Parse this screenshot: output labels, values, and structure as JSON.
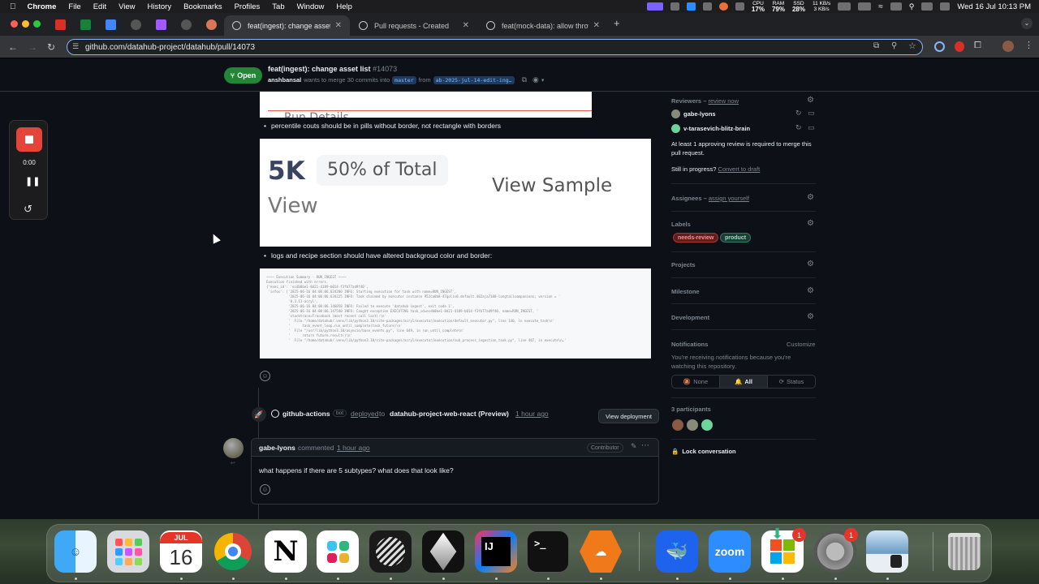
{
  "menubar": {
    "app": "Chrome",
    "items": [
      "File",
      "Edit",
      "View",
      "History",
      "Bookmarks",
      "Profiles",
      "Tab",
      "Window",
      "Help"
    ],
    "cpu_label": "CPU",
    "cpu": "17%",
    "ram_label": "RAM",
    "ram": "79%",
    "ssd_label": "SSD",
    "ssd": "28%",
    "net_up": "11 KB/s",
    "net_down": "3 KB/s",
    "clock": "Wed 16 Jul 10:13 PM"
  },
  "tabs": [
    {
      "title": "feat(ingest): change asset lis"
    },
    {
      "title": "Pull requests - Created"
    },
    {
      "title": "feat(mock-data): allow throw"
    }
  ],
  "address": {
    "url": "github.com/datahub-project/datahub/pull/14073"
  },
  "pr": {
    "status": "Open",
    "title": "feat(ingest): change asset list",
    "number": "#14073",
    "author": "anshbansal",
    "merge_text": "wants to merge 30 commits into",
    "base": "master",
    "from_text": "from",
    "head": "ab-2025-jul-14-edit-ing…"
  },
  "recorder": {
    "time": "0:00"
  },
  "comment": {
    "bullet1": "percentile couts should be in pills without border, not rectangle with borders",
    "img_partial": "Run Details",
    "img_count": "5K",
    "img_percent": "50% of Total",
    "img_view": "View",
    "img_sample": "View Sample",
    "bullet2": "logs and recipe section should have altered backgroud color and border:",
    "logs": [
      "~~~~ Execution Summary - RUN_INGEST ~~~~",
      "Execution finished with errors.",
      "{'exec_id': 'ecdb0be1-8d21-4189-b014-f3fb77ad9f40',",
      " 'infos': ['2025-06-16 04:00:06.624200 INFO: Starting execution for task with name=RUN_INGEST',",
      "           '2025-06-16 04:00:06.634225 INFO: Task claimed by executor instance 952ca0b8-47golis0.default.482aja7180-longtailcompanions; version = '",
      "           '0.3.11-acryl',",
      "           '2025-06-16 04:00:06.146058 INFO: Failed to execute 'datahub ingest', exit code 1',",
      "           '2025-06-16 04:00:06.147540 INFO: Caught exception EXECUTING task_id=ecdb0be1-8d21-4189-b014-f3fb77ad9f40, name=RUN_INGEST, '",
      "           'stacktrace=Traceback (most recent call last):\\n'",
      "           '  File \"/home/datahub/.venv/lib/python3.10/site-packages/acryl/executor/execution/default_executor.py\", line 140, in execute_task\\n'",
      "           '      task_event_loop.run_until_complete(task_future)\\n'",
      "           '  File \"/usr/lib/python3.10/asyncio/base_events.py\", line 649, in run_until_complete\\n'",
      "           '      return future.result()\\n'",
      "           '  File \"/home/datahub/.venv/lib/python3.10/site-packages/acryl/executor/execution/sub_process_ingestion_task.py\", line 407, in execute\\n…'"
    ]
  },
  "deploy": {
    "actor": "github-actions",
    "bot": "bot",
    "deployed": "deployed",
    "to": "to",
    "env": "datahub-project-web-react (Preview)",
    "time": "1 hour ago",
    "button": "View deployment"
  },
  "reply": {
    "author": "gabe-lyons",
    "commented": "commented",
    "time": "1 hour ago",
    "role": "Contributor",
    "body": "what happens if there are 5 subtypes? what does that look like?"
  },
  "sidebar": {
    "reviewers_label": "Reviewers –",
    "review_now": "review now",
    "reviewer1": "gabe-lyons",
    "reviewer2": "v-tarasevich-blitz-brain",
    "approval_note": "At least 1 approving review is required to merge this pull request.",
    "in_progress": "Still in progress?",
    "convert_draft": "Convert to draft",
    "assignees_label": "Assignees –",
    "assign_yourself": "assign yourself",
    "labels_label": "Labels",
    "label1": "needs-review",
    "label2": "product",
    "projects_label": "Projects",
    "milestone_label": "Milestone",
    "development_label": "Development",
    "notifications_label": "Notifications",
    "customize": "Customize",
    "notif_note": "You're receiving notifications because you're watching this repository.",
    "notif_none": "None",
    "notif_all": "All",
    "notif_status": "Status",
    "participants": "3 participants",
    "lock": "Lock conversation"
  },
  "dock": {
    "cal_month": "JUL",
    "cal_day": "16",
    "notion": "N",
    "intellij": "IJ",
    "terminal": ">_",
    "zoom": "zoom",
    "badge1": "1",
    "badge2": "1"
  }
}
